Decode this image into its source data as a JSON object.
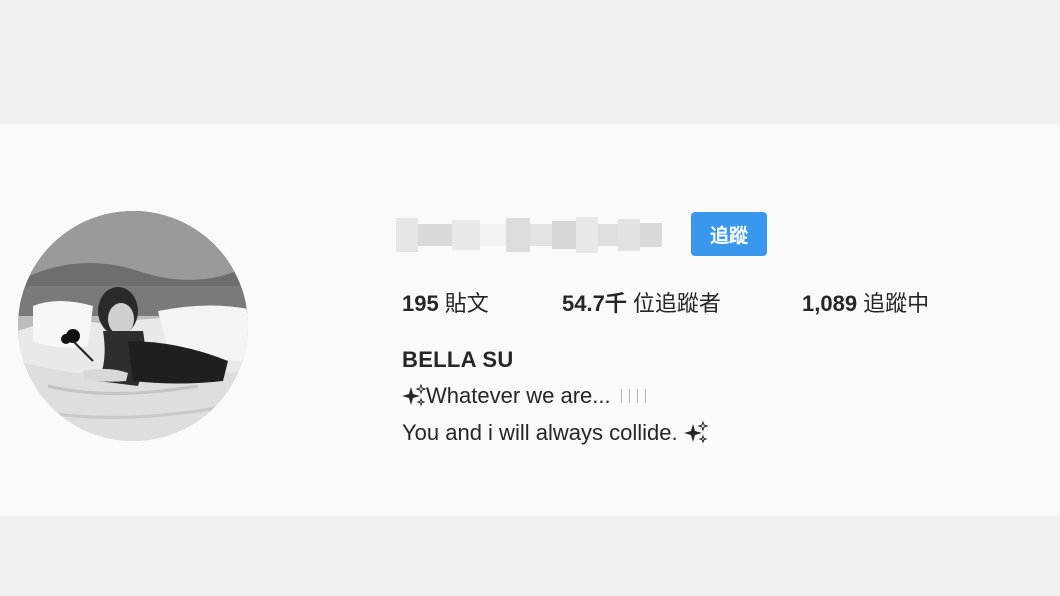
{
  "profile": {
    "follow_label": "追蹤",
    "stats": {
      "posts": {
        "value": "195",
        "label": "貼文"
      },
      "followers": {
        "value": "54.7千",
        "label": "位追蹤者"
      },
      "following": {
        "value": "1,089",
        "label": "追蹤中"
      }
    },
    "full_name": "BELLA SU",
    "bio_line1": "Whatever we are...",
    "bio_line2": "You and i will always collide.",
    "icons": {
      "bio_line1": "sparkles-icon",
      "bio_line2": "sparkles-icon"
    }
  },
  "colors": {
    "follow_button": "#3a97ee",
    "page_background": "#f0f0f0",
    "profile_background": "#fafafa",
    "text": "#262626"
  }
}
